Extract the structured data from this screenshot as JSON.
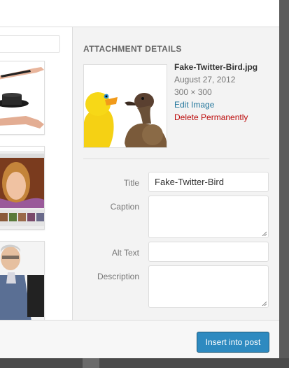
{
  "attachment_details": {
    "heading": "ATTACHMENT DETAILS",
    "filename": "Fake-Twitter-Bird.jpg",
    "date": "August 27, 2012",
    "dimensions": "300 × 300",
    "edit_link": "Edit Image",
    "delete_link": "Delete Permanently",
    "preview_icon": "ducks-image"
  },
  "fields": {
    "title_label": "Title",
    "title_value": "Fake-Twitter-Bird",
    "caption_label": "Caption",
    "caption_value": "",
    "alt_label": "Alt Text",
    "alt_value": "",
    "description_label": "Description",
    "description_value": ""
  },
  "footer": {
    "insert_button": "Insert into post"
  },
  "colors": {
    "link": "#21759b",
    "delete": "#bc0b0b",
    "primary_button": "#2e8ac0"
  }
}
